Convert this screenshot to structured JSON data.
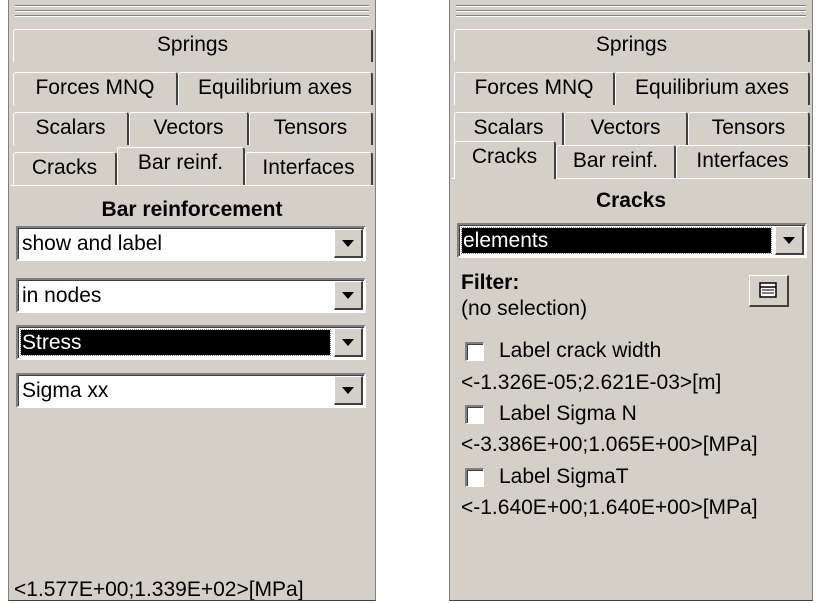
{
  "left_panel": {
    "tabs": {
      "springs": "Springs",
      "forces": "Forces MNQ",
      "equilibrium": "Equilibrium axes",
      "scalars": "Scalars",
      "vectors": "Vectors",
      "tensors": "Tensors",
      "cracks": "Cracks",
      "bar_reinf": "Bar reinf.",
      "interfaces": "Interfaces"
    },
    "active_tab": "Bar reinf.",
    "title": "Bar reinforcement",
    "combos": [
      "show and label",
      "in nodes",
      "Stress",
      "Sigma xx"
    ],
    "selected_combo": "Stress",
    "range_text": "<1.577E+00;1.339E+02>[MPa]"
  },
  "right_panel": {
    "tabs": {
      "springs": "Springs",
      "forces": "Forces MNQ",
      "equilibrium": "Equilibrium axes",
      "scalars": "Scalars",
      "vectors": "Vectors",
      "tensors": "Tensors",
      "cracks": "Cracks",
      "bar_reinf": "Bar reinf.",
      "interfaces": "Interfaces"
    },
    "active_tab": "Cracks",
    "title": "Cracks",
    "combo": "elements",
    "filter_label": "Filter:",
    "filter_value": "(no selection)",
    "items": [
      {
        "label": "Label crack width",
        "range": "<-1.326E-05;2.621E-03>[m]",
        "checked": false
      },
      {
        "label": "Label Sigma N",
        "range": "<-3.386E+00;1.065E+00>[MPa]",
        "checked": false
      },
      {
        "label": "Label SigmaT",
        "range": "<-1.640E+00;1.640E+00>[MPa]",
        "checked": false
      }
    ],
    "filter_button_icon": "table-icon"
  }
}
